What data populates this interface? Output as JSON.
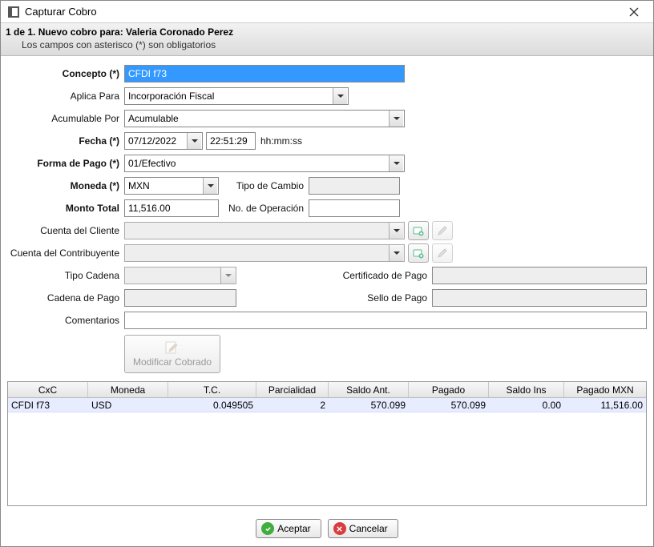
{
  "window": {
    "title": "Capturar Cobro"
  },
  "header": {
    "line1": "1 de 1. Nuevo cobro para: Valeria Coronado Perez",
    "line2": "Los campos con asterisco (*) son obligatorios"
  },
  "labels": {
    "concepto": "Concepto (*)",
    "aplica_para": "Aplica Para",
    "acumulable": "Acumulable Por",
    "fecha": "Fecha (*)",
    "hhmmss": "hh:mm:ss",
    "forma_pago": "Forma de Pago (*)",
    "moneda": "Moneda (*)",
    "tipo_cambio": "Tipo de Cambio",
    "monto_total": "Monto Total",
    "no_operacion": "No. de Operación",
    "cuenta_cliente": "Cuenta del Cliente",
    "cuenta_contrib": "Cuenta del Contribuyente",
    "tipo_cadena": "Tipo Cadena",
    "cert_pago": "Certificado de Pago",
    "cadena_pago": "Cadena de Pago",
    "sello_pago": "Sello de Pago",
    "comentarios": "Comentarios",
    "modificar_cobrado": "Modificar Cobrado"
  },
  "values": {
    "concepto": "CFDI f73",
    "aplica_para": "Incorporación Fiscal",
    "acumulable": "Acumulable",
    "fecha": "07/12/2022",
    "hora": "22:51:29",
    "forma_pago": "01/Efectivo",
    "moneda": "MXN",
    "tipo_cambio": "",
    "monto_total": "11,516.00",
    "no_operacion": "",
    "cuenta_cliente": "",
    "cuenta_contrib": "",
    "tipo_cadena": "",
    "cert_pago": "",
    "cadena_pago": "",
    "sello_pago": "",
    "comentarios": ""
  },
  "grid": {
    "headers": {
      "cxc": "CxC",
      "moneda": "Moneda",
      "tc": "T.C.",
      "parcialidad": "Parcialidad",
      "saldo_ant": "Saldo Ant.",
      "pagado": "Pagado",
      "saldo_ins": "Saldo Ins",
      "pagado_mxn": "Pagado MXN"
    },
    "row": {
      "cxc": "CFDI f73",
      "moneda": "USD",
      "tc": "0.049505",
      "parcialidad": "2",
      "saldo_ant": "570.099",
      "pagado": "570.099",
      "saldo_ins": "0.00",
      "pagado_mxn": "11,516.00"
    }
  },
  "buttons": {
    "aceptar": "Aceptar",
    "cancelar": "Cancelar"
  }
}
